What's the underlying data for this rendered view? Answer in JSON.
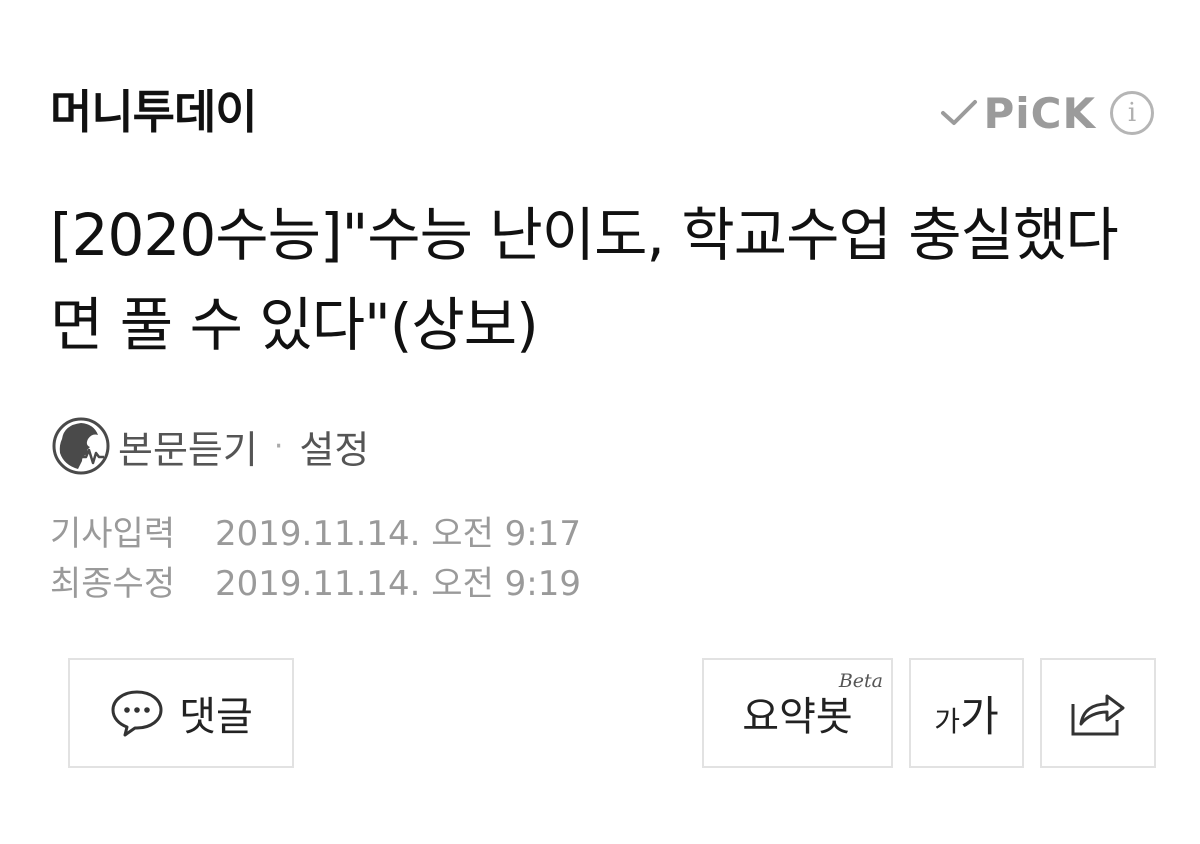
{
  "press": {
    "name": "머니투데이"
  },
  "pick": {
    "label": "PiCK",
    "info_label": "i"
  },
  "article": {
    "headline": "[2020수능]\"수능 난이도, 학교수업 충실했다면 풀 수 있다\"(상보)"
  },
  "tts": {
    "listen_label": "본문듣기",
    "separator": "·",
    "settings_label": "설정"
  },
  "meta": {
    "published_label": "기사입력",
    "published_value": "2019.11.14. 오전 9:17",
    "updated_label": "최종수정",
    "updated_value": "2019.11.14. 오전 9:19"
  },
  "actions": {
    "comment_label": "댓글",
    "summary_label": "요약봇",
    "summary_badge": "Beta",
    "font_small": "가",
    "font_big": "가"
  },
  "icons": {
    "check": "check-icon",
    "info": "info-icon",
    "tts": "speaker-face-icon",
    "comment": "speech-bubble-icon",
    "share": "share-icon"
  },
  "colors": {
    "text": "#111111",
    "muted": "#9a9a9a",
    "pick": "#9b9b9b",
    "border": "#e2e2e2"
  }
}
